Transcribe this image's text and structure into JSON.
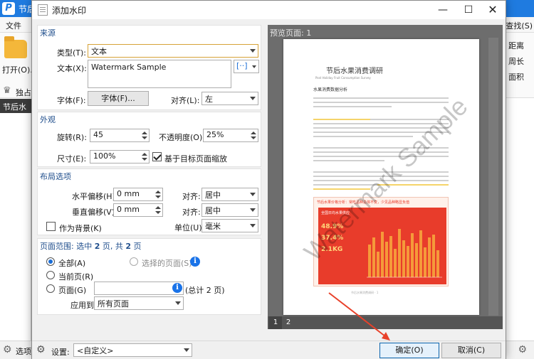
{
  "background_app": {
    "title": "节后",
    "menu_file": "文件",
    "menu_right": "查找(S)",
    "open_label": "打开(O)...",
    "unique_label": "独占",
    "right_items": [
      "距离",
      "周长",
      "面积"
    ],
    "tab_label": "节后水果",
    "status_label": "选项"
  },
  "dialog": {
    "title": "添加水印",
    "source": {
      "title": "来源",
      "type_label": "类型(T):",
      "type_value": "文本",
      "text_label": "文本(X):",
      "text_value": "Watermark Sample",
      "font_label": "字体(F):",
      "font_button": "字体(F)...",
      "align_label": "对齐(L):",
      "align_value": "左"
    },
    "appearance": {
      "title": "外观",
      "rotation_label": "旋转(R):",
      "rotation_value": "45",
      "opacity_label": "不透明度(O):",
      "opacity_value": "25%",
      "size_label": "尺寸(E):",
      "size_value": "100%",
      "scale_label": "基于目标页面缩放",
      "scale_checked": true
    },
    "layout": {
      "title": "布局选项",
      "hoffset_label": "水平偏移(H):",
      "hoffset_value": "0 mm",
      "voffset_label": "垂直偏移(V):",
      "voffset_value": "0 mm",
      "halign_label": "对齐:",
      "halign_value": "居中",
      "valign_label": "对齐:",
      "valign_value": "居中",
      "unit_label": "单位(U):",
      "unit_value": "毫米",
      "background_label": "作为背景(K)",
      "background_checked": false
    },
    "range": {
      "title_prefix": "页面范围: 选中 ",
      "selected": "2",
      "title_mid": " 页, 共 ",
      "total": "2",
      "title_suffix": " 页",
      "all_label": "全部(A)",
      "selected_pages_label": "选择的页面(S)",
      "current_label": "当前页(R)",
      "pages_label": "页面(G)",
      "pages_value": "",
      "total_hint": "(总计 2 页)",
      "apply_label": "应用到:",
      "apply_value": "所有页面"
    },
    "preview": {
      "label": "预览页面: 1",
      "pages": [
        "1",
        "2"
      ]
    },
    "page_content": {
      "title": "节后水果消费调研",
      "subtitle": "Post Holiday Fruit Consumption Survey",
      "section": "水果消费数据分析",
      "chart_title": "节后水果价格分析：常吃品种总体不变，少见品种略显负值",
      "chart_inner_title": "全国日均水果供应",
      "stat1": "48.9%",
      "stat2": "37.4%",
      "stat3": "2.1KG",
      "footer": "节后水果消费调研 · 1",
      "watermark": "Watermark Sample"
    },
    "settings_label": "设置:",
    "settings_value": "<自定义>",
    "ok_button": "确定(O)",
    "cancel_button": "取消(C)"
  },
  "colors": {
    "accent": "#1f7be0",
    "chart_red": "#e83c2b",
    "highlight": "#f5d46a",
    "annotation_arrow": "#e8412a"
  }
}
